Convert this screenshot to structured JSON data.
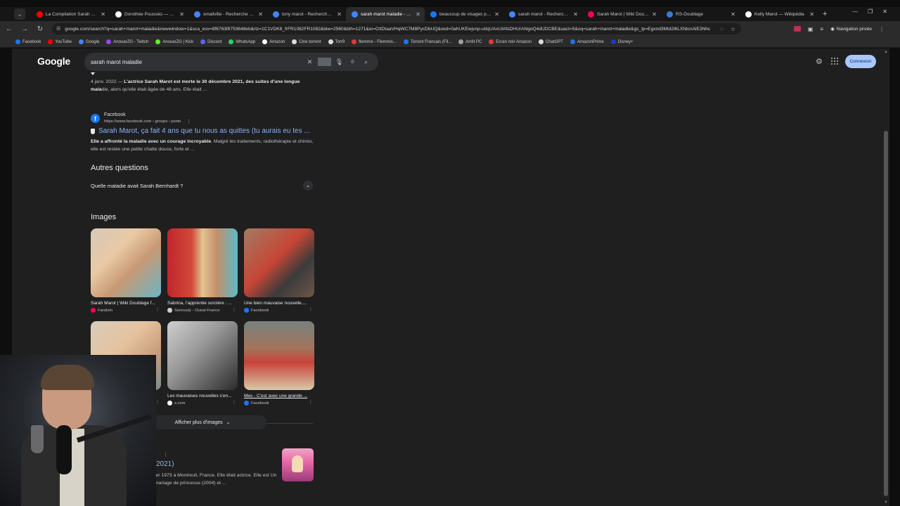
{
  "browser": {
    "tabs": [
      {
        "title": "La Compilation Sarah Marot",
        "fav": "youtube-icon",
        "color": "#ff0000",
        "active": false
      },
      {
        "title": "Dorothée Pousséo — Wikipé",
        "fav": "wikipedia-icon",
        "color": "#ffffff",
        "active": false
      },
      {
        "title": "smallville - Recherche Google",
        "fav": "google-icon",
        "color": "#4285f4",
        "active": false
      },
      {
        "title": "tony marot - Recherche Goo",
        "fav": "google-icon",
        "color": "#4285f4",
        "active": false
      },
      {
        "title": "sarah marot maladie - Reche",
        "fav": "google-icon",
        "color": "#4285f4",
        "active": true
      },
      {
        "title": "beaucoup de visages pour un",
        "fav": "facebook-icon",
        "color": "#1877f2",
        "active": false
      },
      {
        "title": "sarah marot - Recherche Goo",
        "fav": "google-icon",
        "color": "#4285f4",
        "active": false
      },
      {
        "title": "Sarah Marot | Wiki Doublage",
        "fav": "fandom-icon",
        "color": "#fa005a",
        "active": false
      },
      {
        "title": "RS-Doublage",
        "fav": "rs-icon",
        "color": "#3a7bd5",
        "active": false
      },
      {
        "title": "Kelly Marot — Wikipédia",
        "fav": "wikipedia-icon",
        "color": "#ffffff",
        "active": false
      }
    ],
    "url": "google.com/search?q=sarah+marot+maladie&newwindow=1&sca_esv=8f6763f8753648eb&rlz=1C1VDK8_frFR1082FR1082&biw=2560&bih=1271&ei=O3DtaaVHqWC7M8PycDbUQ&ved=0ahUKEwjvnp-utIqUAxUIAfsDHUrANgoQ4dUDCBE&uact=5&oq=sarah+marot+maladie&gs_lp=Egxnd3Mtd2l6LXNlcnAiE3Nhc",
    "private_label": "Navigation privée",
    "bookmarks": [
      {
        "label": "Facebook",
        "color": "#1877f2"
      },
      {
        "label": "YouTube",
        "color": "#ff0000"
      },
      {
        "label": "Google",
        "color": "#4285f4"
      },
      {
        "label": "AnouarZG - Twitch",
        "color": "#9146ff"
      },
      {
        "label": "AnouarZG | Kick",
        "color": "#53fc18"
      },
      {
        "label": "Discord",
        "color": "#5865f2"
      },
      {
        "label": "WhatsApp",
        "color": "#25d366"
      },
      {
        "label": "Amazon",
        "color": "#ffffff"
      },
      {
        "label": "Cine torrent",
        "color": "#dddddd"
      },
      {
        "label": "Torr9",
        "color": "#dddddd"
      },
      {
        "label": "flemmix - Flemmix...",
        "color": "#e53935"
      },
      {
        "label": "Torrent Francais (Fil...",
        "color": "#1877f2"
      },
      {
        "label": "Arrêt PC",
        "color": "#9aa0a6"
      },
      {
        "label": "Ecran noir Amazon",
        "color": "#e53935"
      },
      {
        "label": "ChatGPT",
        "color": "#dddddd"
      },
      {
        "label": "AmazonPrime",
        "color": "#1a73e8"
      },
      {
        "label": "Disney+",
        "color": "#113ccf"
      }
    ]
  },
  "search": {
    "logo": "Google",
    "query": "sarah marot maladie",
    "signin_label": "Connexion"
  },
  "results": {
    "snippet1": {
      "date": "4 janv. 2022 — ",
      "bold": "L'actrice Sarah Marot est morte le 30 décembre 2021, des suites d'une longue mala",
      "rest": "die, alors qu'elle était âgée de 48 ans. Elle était ..."
    },
    "facebook": {
      "source": "Facebook",
      "url": "https://www.facebook.com › groups › posts",
      "title": "Sarah Marot, ça fait 4 ans que tu nous as quittes (tu aurais eu tes ...",
      "bold": "Elle a affronté la maladie avec un courage incroyable",
      "rest": ". Malgré les traitements, radiothérapie et chimio, elle est restée une petite chatte douce, forte et ..."
    },
    "questions_heading": "Autres questions",
    "question1": "Quelle maladie avait Sarah Bernhardt ?",
    "images_heading": "Images",
    "images": [
      {
        "caption": "Sarah Marot | Wiki Doublage f...",
        "source": "Fandom",
        "src_color": "#fa005a"
      },
      {
        "caption": "Sabrina, l'apprentie sorcière : ...",
        "source": "Seriously - Ouest-France",
        "src_color": "#d0d0d0"
      },
      {
        "caption": "Une bien mauvaise nouvelle....",
        "source": "Facebook",
        "src_color": "#1877f2"
      },
      {
        "caption": "Sarah Marot | Memory Alpha |...",
        "source": "Memory Alpha - Fandom",
        "src_color": "#fa005a"
      },
      {
        "caption": "Les mauvaises nouvelles s'en...",
        "source": "x.com",
        "src_color": "#ffffff"
      },
      {
        "caption": "Mes - C'est avec une grande ...",
        "source": "Facebook",
        "src_color": "#1877f2"
      }
    ],
    "more_images": "Afficher plus d'images",
    "kp_title": "2021)",
    "kp_snip": "ier 1973 à Montreuil, France. Elle était actrice. Elle est Un mariage de princesse (2004) et ..."
  }
}
